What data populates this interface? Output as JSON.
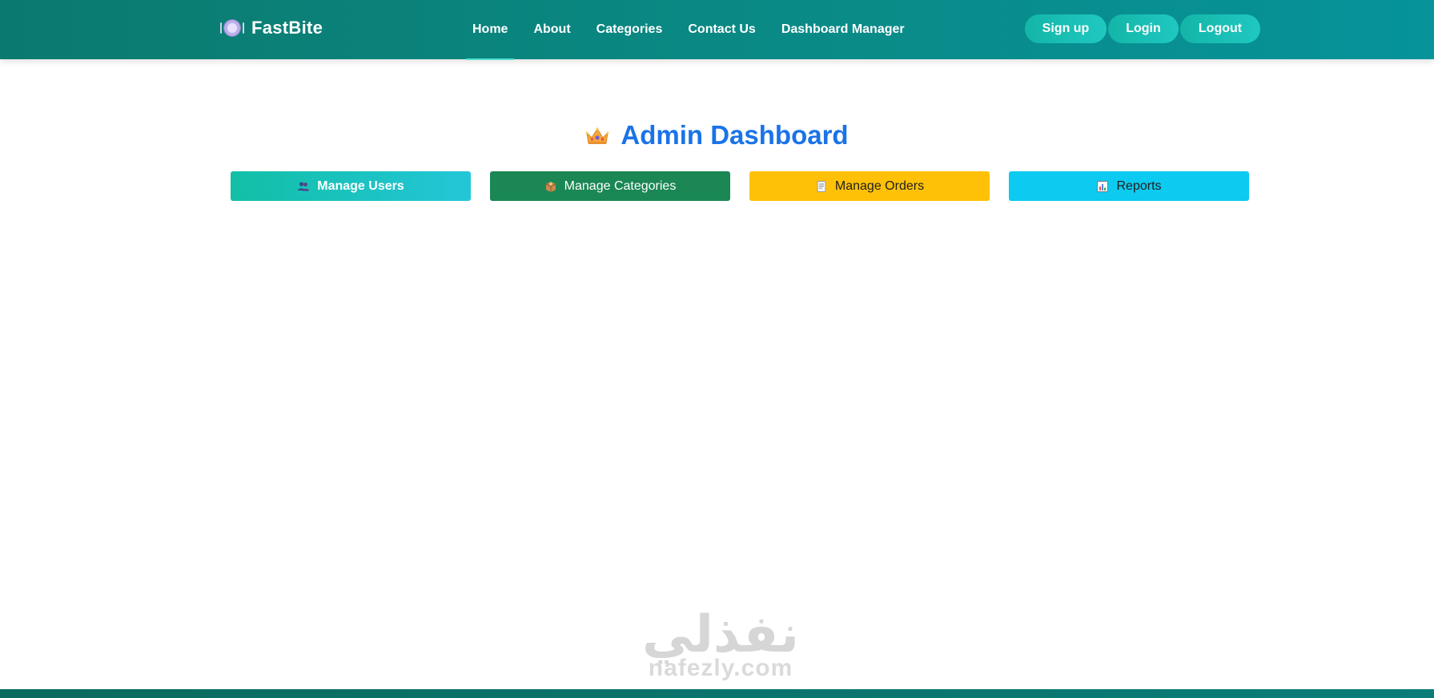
{
  "brand": {
    "name": "FastBite",
    "icon": "plate-icon"
  },
  "nav": {
    "links": [
      {
        "label": "Home",
        "active": true
      },
      {
        "label": "About"
      },
      {
        "label": "Categories"
      },
      {
        "label": "Contact Us"
      },
      {
        "label": "Dashboard Manager"
      }
    ]
  },
  "auth": {
    "signup_label": "Sign up",
    "login_label": "Login",
    "logout_label": "Logout"
  },
  "main": {
    "title": "Admin Dashboard",
    "title_icon": "crown-icon",
    "actions": [
      {
        "label": "Manage Users",
        "icon": "users-icon",
        "color": "#14bfae"
      },
      {
        "label": "Manage Categories",
        "icon": "package-icon",
        "color": "#1a8754"
      },
      {
        "label": "Manage Orders",
        "icon": "receipt-icon",
        "color": "#ffc107"
      },
      {
        "label": "Reports",
        "icon": "bar-chart-icon",
        "color": "#0dcaf0"
      }
    ]
  },
  "watermark": {
    "arabic": "نفذلي",
    "latin": "nafezly.com"
  },
  "colors": {
    "navbar": "#0a8a86",
    "accent": "#1a73e8",
    "active_underline": "#4be0d0"
  }
}
